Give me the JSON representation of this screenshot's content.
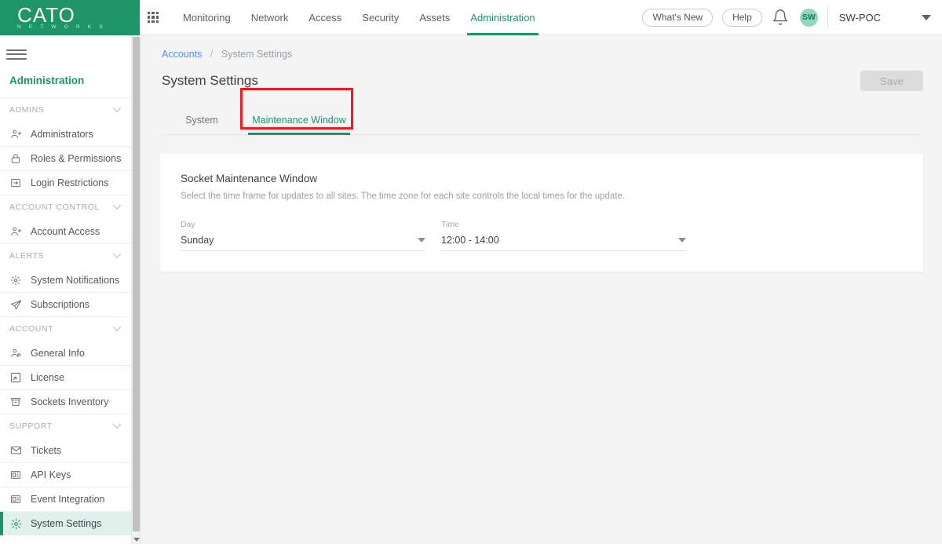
{
  "brand": {
    "logo_text": "CATO",
    "logo_subtext": "N E T W O R K S",
    "accent_green": "#1e9568",
    "highlight_red": "#ee1d24",
    "link_blue": "#5b8def"
  },
  "topnav": {
    "apps_icon": "apps-grid-icon",
    "items": [
      {
        "label": "Monitoring",
        "active": false
      },
      {
        "label": "Network",
        "active": false
      },
      {
        "label": "Access",
        "active": false
      },
      {
        "label": "Security",
        "active": false
      },
      {
        "label": "Assets",
        "active": false
      },
      {
        "label": "Administration",
        "active": true
      }
    ],
    "whats_new": "What's New",
    "help": "Help",
    "bell_icon": "notification-bell-icon",
    "avatar_initials": "SW",
    "account_name": "SW-POC",
    "account_caret_icon": "chevron-down-icon"
  },
  "sidebar": {
    "menu_icon": "hamburger-menu-icon",
    "title": "Administration",
    "groups": [
      {
        "label": "ADMINS",
        "items": [
          {
            "label": "Administrators",
            "icon": "users-icon",
            "active": false
          },
          {
            "label": "Roles & Permissions",
            "icon": "lock-icon",
            "active": false
          },
          {
            "label": "Login Restrictions",
            "icon": "login-arrow-icon",
            "active": false
          }
        ]
      },
      {
        "label": "ACCOUNT CONTROL",
        "items": [
          {
            "label": "Account Access",
            "icon": "users-icon",
            "active": false
          }
        ]
      },
      {
        "label": "ALERTS",
        "items": [
          {
            "label": "System Notifications",
            "icon": "gear-icon",
            "active": false
          },
          {
            "label": "Subscriptions",
            "icon": "paper-plane-icon",
            "active": false
          }
        ]
      },
      {
        "label": "ACCOUNT",
        "items": [
          {
            "label": "General Info",
            "icon": "user-info-icon",
            "active": false
          },
          {
            "label": "License",
            "icon": "license-square-icon",
            "active": false
          },
          {
            "label": "Sockets Inventory",
            "icon": "inventory-box-icon",
            "active": false
          }
        ]
      },
      {
        "label": "SUPPORT",
        "items": [
          {
            "label": "Tickets",
            "icon": "envelope-icon",
            "active": false
          },
          {
            "label": "API Keys",
            "icon": "api-key-icon",
            "active": false
          },
          {
            "label": "Event Integration",
            "icon": "event-integration-icon",
            "active": false
          },
          {
            "label": "System Settings",
            "icon": "gear-icon",
            "active": true
          }
        ]
      }
    ],
    "scrollbar_down_arrow": "scroll-down-arrow-icon"
  },
  "main": {
    "breadcrumb": {
      "root": "Accounts",
      "separator": "/",
      "current": "System Settings"
    },
    "page_title": "System Settings",
    "save_label": "Save",
    "save_disabled": true,
    "tabs": [
      {
        "label": "System",
        "active": false
      },
      {
        "label": "Maintenance Window",
        "active": true
      }
    ],
    "card": {
      "title": "Socket Maintenance Window",
      "description": "Select the time frame for updates to all sites. The time zone for each site controls the local times for the update.",
      "fields": [
        {
          "label": "Day",
          "value": "Sunday",
          "caret_icon": "chevron-down-icon"
        },
        {
          "label": "Time",
          "value": "12:00 - 14:00",
          "caret_icon": "chevron-down-icon"
        }
      ]
    }
  }
}
